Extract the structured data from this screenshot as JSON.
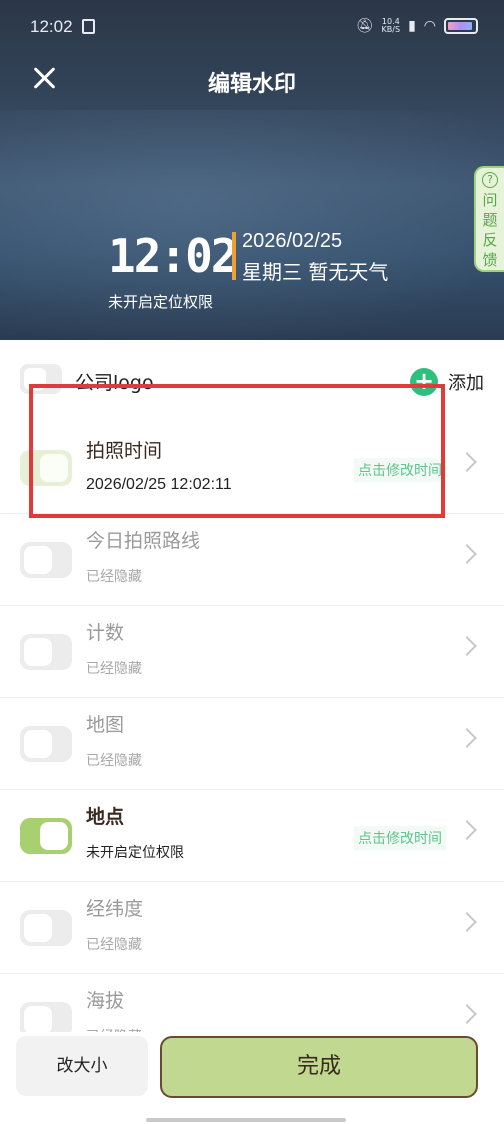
{
  "status": {
    "time": "12:02",
    "speed_top": "10.4",
    "speed_bottom": "KB/S"
  },
  "nav": {
    "title": "编辑水印"
  },
  "watermark": {
    "time": "12:02",
    "date": "2026/02/25",
    "day_weather": "星期三  暂无天气",
    "location": "未开启定位权限",
    "accent_color": "#f0a030"
  },
  "feedback": {
    "chars": [
      "问",
      "题",
      "反",
      "馈"
    ]
  },
  "logo_row": {
    "label": "公司logo",
    "add_label": "添加"
  },
  "rows": [
    {
      "title": "拍照时间",
      "sub": "2026/02/25 12:02:11",
      "action": "点击修改时间",
      "state": "on"
    },
    {
      "title": "今日拍照路线",
      "sub": "已经隐藏",
      "action": "",
      "state": "off"
    },
    {
      "title": "计数",
      "sub": "已经隐藏",
      "action": "",
      "state": "off"
    },
    {
      "title": "地图",
      "sub": "已经隐藏",
      "action": "",
      "state": "off"
    },
    {
      "title": "地点",
      "sub": "未开启定位权限",
      "action": "点击修改时间",
      "state": "on"
    },
    {
      "title": "经纬度",
      "sub": "已经隐藏",
      "action": "",
      "state": "off"
    },
    {
      "title": "海拔",
      "sub": "已经隐藏",
      "action": "",
      "state": "off"
    }
  ],
  "buttons": {
    "resize": "改大小",
    "done": "完成"
  },
  "colors": {
    "toggle_on": "#a8d070",
    "action_green": "#5dc48c",
    "highlight_red": "#e03a3a"
  }
}
